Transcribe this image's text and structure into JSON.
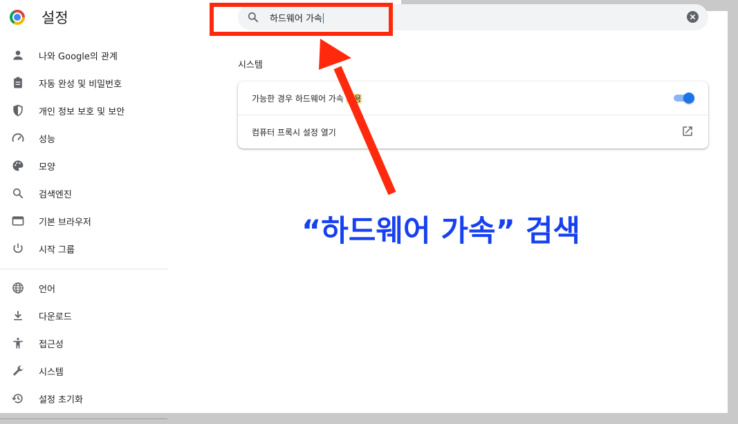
{
  "header": {
    "title": "설정"
  },
  "sidebar": {
    "items": [
      {
        "label": "나와 Google의 관계",
        "icon": "person-icon"
      },
      {
        "label": "자동 완성 및 비밀번호",
        "icon": "clipboard-icon"
      },
      {
        "label": "개인 정보 보호 및 보안",
        "icon": "shield-icon"
      },
      {
        "label": "성능",
        "icon": "speedometer-icon"
      },
      {
        "label": "모양",
        "icon": "palette-icon"
      },
      {
        "label": "검색엔진",
        "icon": "search-icon"
      },
      {
        "label": "기본 브라우저",
        "icon": "browser-icon"
      },
      {
        "label": "시작 그룹",
        "icon": "power-icon"
      },
      {
        "label": "언어",
        "icon": "globe-icon"
      },
      {
        "label": "다운로드",
        "icon": "download-icon"
      },
      {
        "label": "접근성",
        "icon": "accessibility-icon"
      },
      {
        "label": "시스템",
        "icon": "wrench-icon"
      },
      {
        "label": "설정 초기화",
        "icon": "history-icon"
      }
    ]
  },
  "search": {
    "value": "하드웨어 가속"
  },
  "system_section": {
    "title": "시스템",
    "rows": [
      {
        "label_main": "가능한 경우 하드웨어 가속 ",
        "label_highlight": "사용",
        "toggle_on": true
      },
      {
        "label_main": "컴퓨터 프록시 설정 열기"
      }
    ]
  },
  "annotation": {
    "caption": "“하드웨어 가속” 검색",
    "box_color": "#ff2a0d",
    "caption_color": "#1640f0"
  },
  "colors": {
    "accent": "#1a73e8",
    "toggle_track": "#8ab4f8",
    "highlight": "#fde68a"
  }
}
